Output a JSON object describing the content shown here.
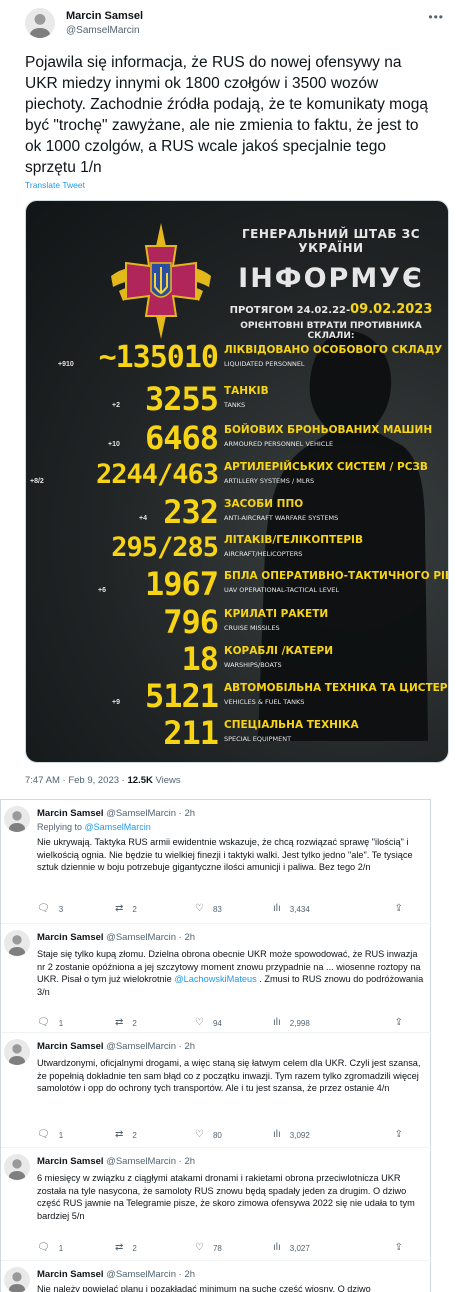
{
  "main_tweet": {
    "author_name": "Marcin Samsel",
    "author_handle": "@SamselMarcin",
    "text": "Pojawila się informacja, że RUS do nowej ofensywy na UKR miedzy innymi ok 1800 czołgów i 3500 wozów piechoty.  Zachodnie źródła podają, że te komunikaty mogą być \"trochę\" zawyżane, ale nie zmienia to faktu, że jest to ok 1000 czolgów, a RUS wcale jakoś specjalnie tego sprzętu 1/n",
    "translate_label": "Translate Tweet",
    "time": "7:47 AM",
    "date": "Feb 9, 2023",
    "views_count": "12.5K",
    "views_label": "Views"
  },
  "infographic": {
    "staff_line": "ГЕНЕРАЛЬНИЙ ШТАБ ЗС УКРАЇНИ",
    "inform_line": "ІНФОРМУЄ",
    "period_prefix": "ПРОТЯГОМ 24.02.22-",
    "period_end": "09.02.2023",
    "losses_line": "ОРІЄНТОВНІ ВТРАТИ ПРОТИВНИКА СКЛАЛИ:",
    "rows": [
      {
        "value": "~135010",
        "delta": "+910",
        "ua": "ЛІКВІДОВАНО ОСОБОВОГО СКЛАДУ",
        "en": "LIQUIDATED PERSONNEL"
      },
      {
        "value": "3255",
        "delta": "+2",
        "ua": "ТАНКІВ",
        "en": "TANKS"
      },
      {
        "value": "6468",
        "delta": "+10",
        "ua": "БОЙОВИХ БРОНЬОВАНИХ МАШИН",
        "en": "ARMOURED PERSONNEL VEHICLE"
      },
      {
        "value": "2244/463",
        "delta": "+8/2",
        "ua": "АРТИЛЕРІЙСЬКИХ СИСТЕМ / РСЗВ",
        "en": "ARTILLERY SYSTEMS / MLRS"
      },
      {
        "value": "232",
        "delta": "+4",
        "ua": "ЗАСОБИ ППО",
        "en": "ANTI-AIRCRAFT WARFARE SYSTEMS"
      },
      {
        "value": "295/285",
        "delta": "",
        "ua": "ЛІТАКІВ/ГЕЛІКОПТЕРІВ",
        "en": "AIRCRAFT/HELICOPTERS"
      },
      {
        "value": "1967",
        "delta": "+6",
        "ua": "БПЛА ОПЕРАТИВНО-ТАКТИЧНОГО РІВНЯ",
        "en": "UAV OPERATIONAL-TACTICAL LEVEL"
      },
      {
        "value": "796",
        "delta": "",
        "ua": "КРИЛАТІ РАКЕТИ",
        "en": "CRUISE MISSILES"
      },
      {
        "value": "18",
        "delta": "",
        "ua": "КОРАБЛІ /КАТЕРИ",
        "en": "WARSHIPS/BOATS"
      },
      {
        "value": "5121",
        "delta": "+9",
        "ua": "АВТОМОБІЛЬНА ТЕХНІКА ТА ЦИСТЕРНИ З ПММ",
        "en": "VEHICLES & FUEL TANKS"
      },
      {
        "value": "211",
        "delta": "",
        "ua": "СПЕЦІАЛЬНА ТЕХНІКА",
        "en": "SPECIAL EQUIPMENT"
      }
    ]
  },
  "replies": [
    {
      "name": "Marcin Samsel",
      "handle": "@SamselMarcin",
      "time": "2h",
      "replying_prefix": "Replying to",
      "replying_handle": "@SamselMarcin",
      "text": "Nie ukrywają. Taktyka RUS armii ewidentnie wskazuje, że chcą rozwiązać sprawę \"ilością\" i  wielkością ognia. Nie będzie tu wielkiej finezji i taktyki walki. Jest tylko jedno \"ale\". Te tysiące sztuk dziennie w boju potrzebuje gigantyczne ilości amunicji i paliwa. Bez tego 2/n",
      "replies": "3",
      "retweets": "2",
      "likes": "83",
      "views": "3,434"
    },
    {
      "name": "Marcin Samsel",
      "handle": "@SamselMarcin",
      "time": "2h",
      "text_before": "Staje się tylko kupą złomu.  Dzielna obrona obecnie UKR może spowodować, że RUS inwazja nr 2 zostanie opóźniona a jej szczytowy moment znowu przypadnie na ... wiosenne roztopy na UKR. Pisał o tym już wielokrotnie ",
      "mention": "@LachowskiMateus",
      "text_after": " .  Zmusi to RUS  znowu do podróżowania 3/n",
      "replies": "1",
      "retweets": "2",
      "likes": "94",
      "views": "2,998"
    },
    {
      "name": "Marcin Samsel",
      "handle": "@SamselMarcin",
      "time": "2h",
      "text": "Utwardzonymi, oficjalnymi drogami, a więc staną się łatwym celem  dla UKR. Czyli jest szansa, że popełnią dokładnie ten sam błąd co z początku  inwazji. Tym razem tylko zgromadzili więcej samolotów i opp do ochrony tych transportów.  Ale i tu jest szansa, że przez ostanie 4/n",
      "replies": "1",
      "retweets": "2",
      "likes": "80",
      "views": "3,092"
    },
    {
      "name": "Marcin Samsel",
      "handle": "@SamselMarcin",
      "time": "2h",
      "text": "6 miesięcy w związku z ciągłymi atakami dronami i rakietami obrona przeciwlotnicza UKR została na tyle nasycona, że samoloty RUS znowu będą spadały jeden za drugim.  O dziwo część RUS jawnie na Telegramie pisze, że skoro zimowa ofensywa 2022 się nie udała to tym bardziej 5/n",
      "replies": "1",
      "retweets": "2",
      "likes": "78",
      "views": "3,027"
    },
    {
      "name": "Marcin Samsel",
      "handle": "@SamselMarcin",
      "time": "2h",
      "text": "Nie należy powielać planu i pozakładać minimum na suche część wiosny. O dziwo"
    }
  ]
}
